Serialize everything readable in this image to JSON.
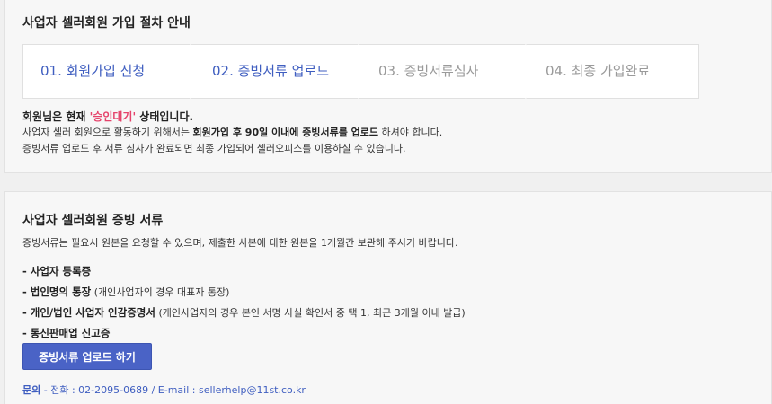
{
  "process": {
    "title": "사업자 셀러회원 가입 절차 안내",
    "steps": [
      {
        "label": "01. 회원가입 신청",
        "state": "active"
      },
      {
        "label": "02. 증빙서류 업로드",
        "state": "active"
      },
      {
        "label": "03. 증빙서류심사",
        "state": "inactive"
      },
      {
        "label": "04. 최종 가입완료",
        "state": "inactive"
      }
    ],
    "status": {
      "prefix": "회원님은 현재 ",
      "badge": "'승인대기'",
      "suffix": " 상태입니다."
    },
    "notice1": {
      "pre": "사업자 셀러 회원으로 활동하기 위해서는 ",
      "bold": "회원가입 후 90일 이내에 증빙서류를 업로드",
      "post": " 하셔야 합니다."
    },
    "notice2": "증빙서류 업로드 후 서류 심사가 완료되면 최종 가입되어 셀러오피스를 이용하실 수 있습니다."
  },
  "documents": {
    "title": "사업자 셀러회원 증빙 서류",
    "description": "증빙서류는 필요시 원본을 요청할 수 있으며, 제출한 사본에 대한 원본을 1개월간 보관해 주시기 바랍니다.",
    "items": [
      {
        "name": "- 사업자 등록증",
        "note": ""
      },
      {
        "name": "- 법인명의 통장",
        "note": " (개인사업자의 경우 대표자 통장)"
      },
      {
        "name": "- 개인/법인 사업자 인감증명서",
        "note": " (개인사업자의 경우 본인 서명 사실 확인서 중 택 1, 최근 3개월 이내 발급)"
      },
      {
        "name": "- 통신판매업 신고증",
        "note": ""
      }
    ],
    "upload_button": "증빙서류 업로드 하기",
    "contact": {
      "label": "문의",
      "text": " - 전화 : 02-2095-0689 / E-mail : sellerhelp@11st.co.kr"
    }
  },
  "colors": {
    "accent": "#3f5ec0",
    "button": "#4a63c6",
    "status_badge": "#e5436b",
    "inactive_step": "#9a9a9a"
  }
}
